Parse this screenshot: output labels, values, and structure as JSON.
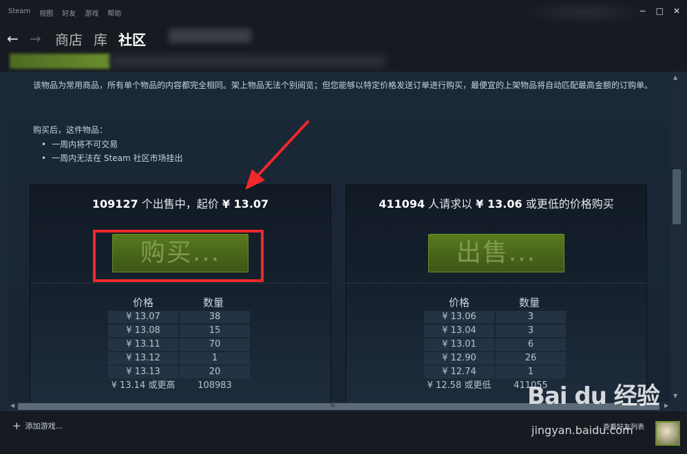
{
  "menu": {
    "items": [
      "Steam",
      "视图",
      "好友",
      "游戏",
      "帮助"
    ]
  },
  "window_controls": {
    "minimize": "−",
    "maximize": "□",
    "close": "✕"
  },
  "nav": {
    "back_icon": "←",
    "forward_icon": "→",
    "links": [
      "商店",
      "库",
      "社区"
    ],
    "active": "社区"
  },
  "content": {
    "description": "该物品为常用商品，所有单个物品的内容都完全相同。架上物品无法个别阅览；但您能够以特定价格发送订单进行购买，最便宜的上架物品将自动匹配最高金额的订购单。",
    "after_purchase_title": "购买后，这件物品：",
    "after_purchase_items": [
      "一周内将不可交易",
      "一周内无法在 Steam 社区市场挂出"
    ]
  },
  "sell_panel": {
    "count": "109127",
    "text": "个出售中，起价",
    "price": "¥ 13.07",
    "button_label": "购买...",
    "columns": [
      "价格",
      "数量"
    ],
    "rows": [
      [
        "¥ 13.07",
        "38"
      ],
      [
        "¥ 13.08",
        "15"
      ],
      [
        "¥ 13.11",
        "70"
      ],
      [
        "¥ 13.12",
        "1"
      ],
      [
        "¥ 13.13",
        "20"
      ]
    ],
    "footer": [
      "¥ 13.14 或更高",
      "108983"
    ]
  },
  "buy_panel": {
    "count": "411094",
    "text_prefix": "人请求以",
    "price": "¥ 13.06",
    "text_suffix": "或更低的价格购买",
    "button_label": "出售...",
    "columns": [
      "价格",
      "数量"
    ],
    "rows": [
      [
        "¥ 13.06",
        "3"
      ],
      [
        "¥ 13.04",
        "3"
      ],
      [
        "¥ 13.01",
        "6"
      ],
      [
        "¥ 12.90",
        "26"
      ],
      [
        "¥ 12.74",
        "1"
      ]
    ],
    "footer": [
      "¥ 12.58 或更低",
      "411055"
    ]
  },
  "bottom": {
    "add_game": "添加游戏...",
    "add_icon": "+",
    "friends_list": "查看好友列表"
  },
  "watermark": {
    "logo": "Bai du 经验",
    "url": "jingyan.baidu.com"
  },
  "colors": {
    "background": "#1b2838",
    "menubar": "#171a21",
    "button_green": "#5a7a1e",
    "annotation_red": "#f0282a"
  }
}
